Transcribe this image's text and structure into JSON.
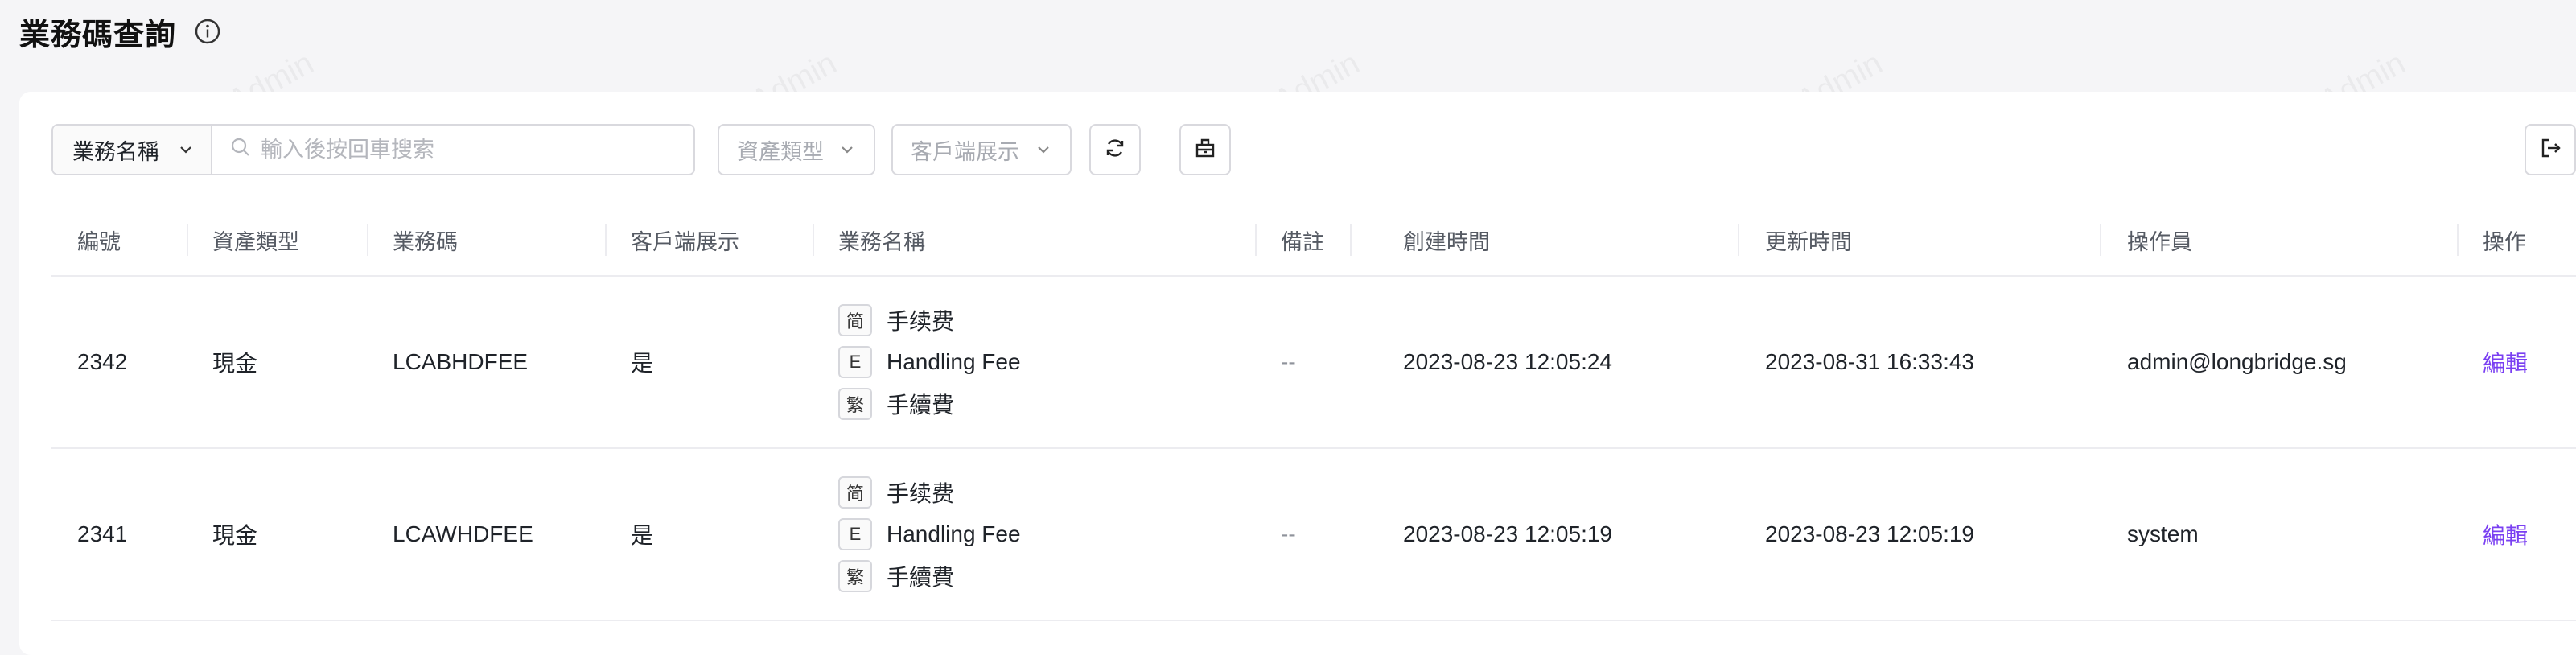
{
  "page": {
    "title": "業務碼查詢",
    "info_icon": "info-circle-icon"
  },
  "toolbar": {
    "search_field_select": "業務名稱",
    "search_placeholder": "輸入後按回車搜索",
    "asset_type_placeholder": "資產類型",
    "client_display_placeholder": "客戶端展示",
    "refresh_icon": "refresh-icon",
    "clear_icon": "clear-icon",
    "export_icon": "export-icon"
  },
  "table": {
    "columns": [
      "編號",
      "資產類型",
      "業務碼",
      "客戶端展示",
      "業務名稱",
      "備註",
      "創建時間",
      "更新時間",
      "操作員",
      "操作"
    ],
    "rows": [
      {
        "id": "2342",
        "asset_type": "現金",
        "code": "LCABHDFEE",
        "client_display": "是",
        "names": [
          {
            "tag": "简",
            "text": "手续费"
          },
          {
            "tag": "E",
            "text": "Handling Fee"
          },
          {
            "tag": "繁",
            "text": "手續費"
          }
        ],
        "remark": "--",
        "created_at": "2023-08-23 12:05:24",
        "updated_at": "2023-08-31 16:33:43",
        "operator": "admin@longbridge.sg",
        "action": "編輯"
      },
      {
        "id": "2341",
        "asset_type": "現金",
        "code": "LCAWHDFEE",
        "client_display": "是",
        "names": [
          {
            "tag": "简",
            "text": "手续费"
          },
          {
            "tag": "E",
            "text": "Handling Fee"
          },
          {
            "tag": "繁",
            "text": "手續費"
          }
        ],
        "remark": "--",
        "created_at": "2023-08-23 12:05:19",
        "updated_at": "2023-08-23 12:05:19",
        "operator": "system",
        "action": "編輯"
      }
    ]
  },
  "watermark_text": "LongPort Test Admin",
  "colors": {
    "accent_link": "#7a3ff2",
    "background": "#f5f5f7"
  }
}
